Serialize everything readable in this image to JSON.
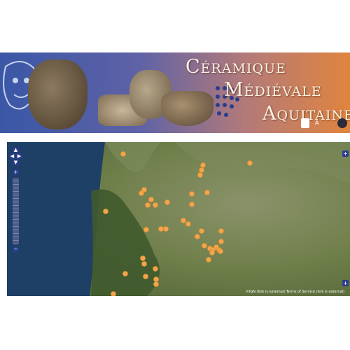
{
  "banner": {
    "title_line1": "Céramique",
    "title_line2": "Médiévale",
    "title_line3": "Aquitaine",
    "logo_text": "A"
  },
  "map": {
    "nav": {
      "up": "▲",
      "left": "◀",
      "right": "▶",
      "down": "▼",
      "zoom_in": "+",
      "zoom_out": "−"
    },
    "layer_switcher": "+",
    "overview_toggle": "+",
    "attribution": "©IGN (link is external) Terms of Service (link is external)",
    "colors": {
      "sea": "#1e3f66",
      "land": "#6f7f4a",
      "forest": "#3f5a2e",
      "site_marker": "#f2a54a"
    }
  }
}
